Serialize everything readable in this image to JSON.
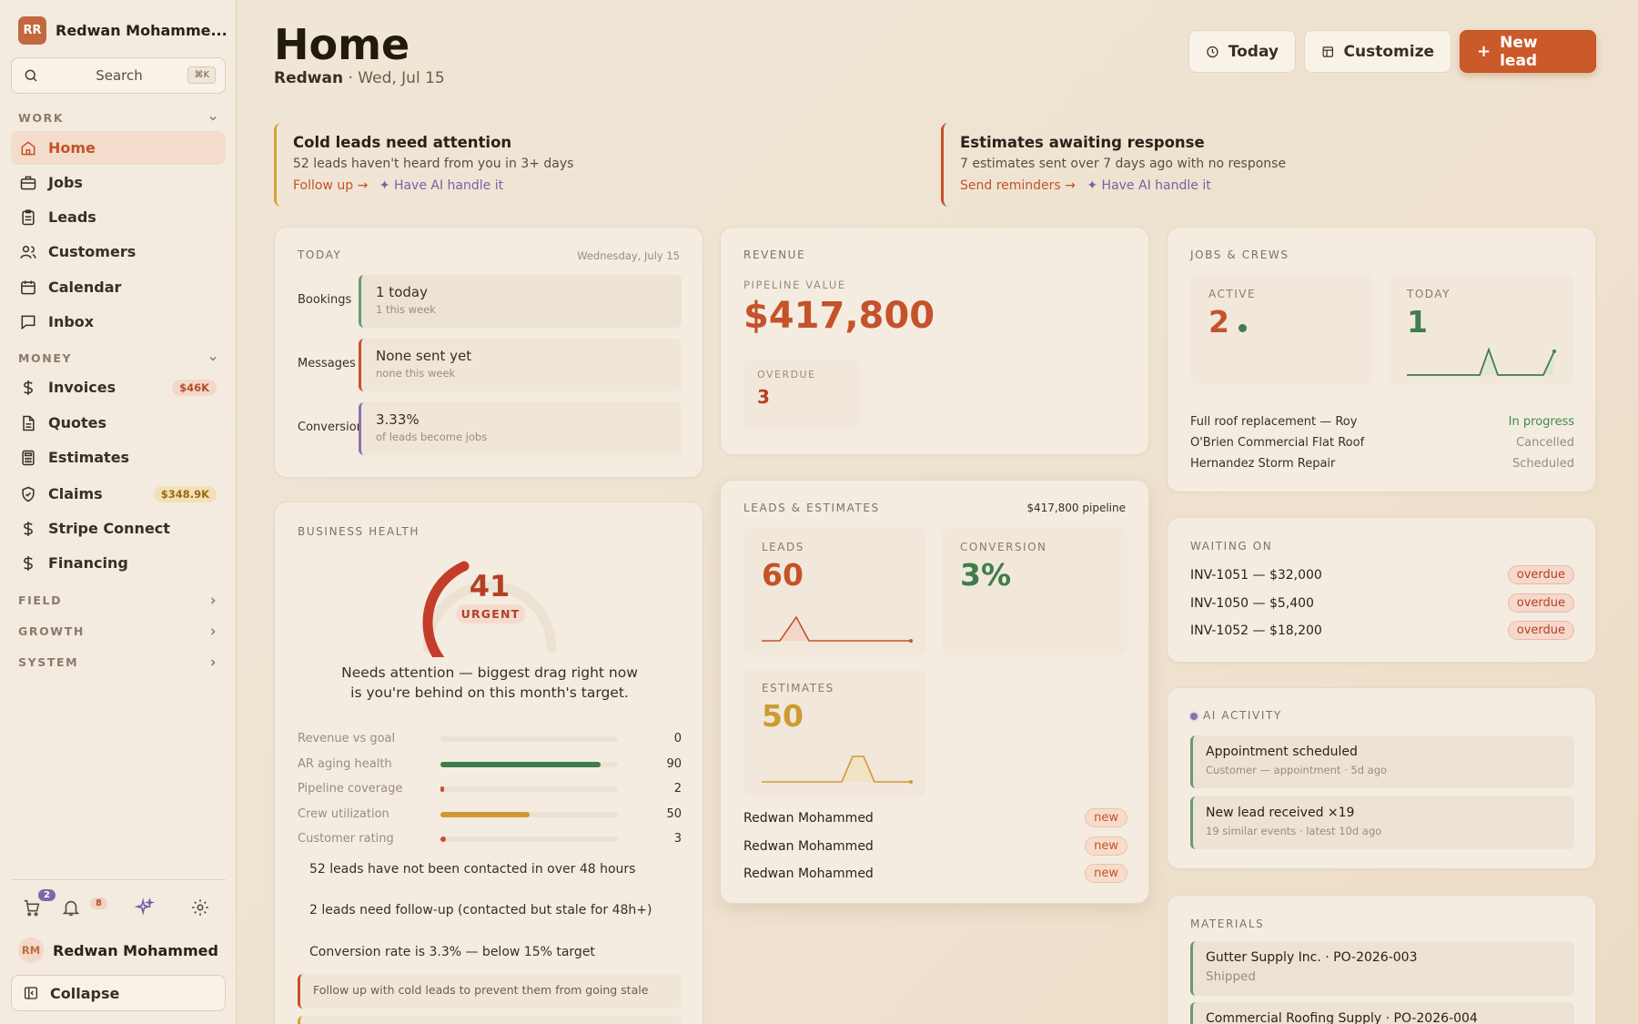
{
  "account": {
    "initials": "RR",
    "name": "Redwan Mohamme..."
  },
  "search": {
    "label": "Search",
    "shortcut": "⌘K"
  },
  "sidebar": {
    "work_label": "WORK",
    "money_label": "MONEY",
    "field_label": "FIELD",
    "growth_label": "GROWTH",
    "system_label": "SYSTEM",
    "work_items": [
      {
        "label": "Home",
        "icon": "home-icon"
      },
      {
        "label": "Jobs",
        "icon": "briefcase-icon"
      },
      {
        "label": "Leads",
        "icon": "clipboard-icon"
      },
      {
        "label": "Customers",
        "icon": "users-icon"
      },
      {
        "label": "Calendar",
        "icon": "calendar-icon"
      },
      {
        "label": "Inbox",
        "icon": "message-icon"
      }
    ],
    "money_items": [
      {
        "label": "Invoices",
        "badge": "$46K"
      },
      {
        "label": "Quotes",
        "badge": ""
      },
      {
        "label": "Estimates",
        "badge": ""
      },
      {
        "label": "Claims",
        "badge": "$348.9K"
      },
      {
        "label": "Stripe Connect",
        "badge": ""
      },
      {
        "label": "Financing",
        "badge": ""
      }
    ],
    "cart_badge": "2",
    "notif_badge": "8",
    "user": {
      "initials": "RM",
      "name": "Redwan Mohammed"
    },
    "collapse_label": "Collapse"
  },
  "header": {
    "title": "Home",
    "user": "Redwan",
    "sep": "·",
    "date": "Wed, Jul 15",
    "today_btn": "Today",
    "customize_btn": "Customize",
    "new_lead_btn": "New lead"
  },
  "alerts": [
    {
      "title": "Cold leads need attention",
      "desc": "52 leads haven't heard from you in 3+ days",
      "action": "Follow up →",
      "ai": "✦ Have AI handle it"
    },
    {
      "title": "Estimates awaiting response",
      "desc": "7 estimates sent over 7 days ago with no response",
      "action": "Send reminders →",
      "ai": "✦ Have AI handle it"
    }
  ],
  "today": {
    "label": "TODAY",
    "date": "Wednesday, July 15",
    "rows": [
      {
        "label": "Bookings",
        "main": "1 today",
        "sub": "1 this week"
      },
      {
        "label": "Messages",
        "main": "None sent yet",
        "sub": "none this week"
      },
      {
        "label": "Conversion",
        "main": "3.33%",
        "sub": "of leads become jobs"
      }
    ]
  },
  "revenue": {
    "label": "REVENUE",
    "pipeline_label": "PIPELINE VALUE",
    "pipeline_value": "$417,800",
    "overdue_label": "OVERDUE",
    "overdue_value": "3"
  },
  "jobs": {
    "label": "JOBS & CREWS",
    "active_label": "ACTIVE",
    "active_value": "2",
    "today_label": "TODAY",
    "today_value": "1",
    "rows": [
      {
        "name": "Full roof replacement — Roy",
        "status": "In progress"
      },
      {
        "name": "O'Brien Commercial Flat Roof",
        "status": "Cancelled"
      },
      {
        "name": "Hernandez Storm Repair",
        "status": "Scheduled"
      }
    ]
  },
  "health": {
    "label": "BUSINESS HEALTH",
    "score": "41",
    "score_fraction": 0.41,
    "status": "URGENT",
    "message_1": "Needs attention — biggest drag right now",
    "message_2": "is you're behind on this month's target.",
    "metrics": [
      {
        "label": "Revenue vs goal",
        "value": 0,
        "display": "0",
        "color": "#c9502c"
      },
      {
        "label": "AR aging health",
        "value": 90,
        "display": "90",
        "color": "#3f7d4a"
      },
      {
        "label": "Pipeline coverage",
        "value": 2,
        "display": "2",
        "color": "#c9502c"
      },
      {
        "label": "Crew utilization",
        "value": 50,
        "display": "50",
        "color": "#cf9a33"
      },
      {
        "label": "Customer rating",
        "value": 3,
        "display": "3",
        "color": "#c9502c"
      }
    ],
    "notes": [
      "52 leads have not been contacted in over 48 hours",
      "2 leads need follow-up (contacted but stale for 48h+)",
      "Conversion rate is 3.3% — below 15% target"
    ],
    "action": "Follow up with cold leads to prevent them from going stale"
  },
  "leads": {
    "label": "LEADS & ESTIMATES",
    "pipeline": "$417,800 pipeline",
    "leads_label": "LEADS",
    "leads_value": "60",
    "conversion_label": "CONVERSION",
    "conversion_value": "3%",
    "estimates_label": "ESTIMATES",
    "estimates_value": "50",
    "rows": [
      {
        "name": "Redwan Mohammed",
        "tag": "new"
      },
      {
        "name": "Redwan Mohammed",
        "tag": "new"
      },
      {
        "name": "Redwan Mohammed",
        "tag": "new"
      }
    ]
  },
  "waiting": {
    "label": "WAITING ON",
    "rows": [
      {
        "name": "INV-1051 — $32,000",
        "tag": "overdue"
      },
      {
        "name": "INV-1050 — $5,400",
        "tag": "overdue"
      },
      {
        "name": "INV-1052 — $18,200",
        "tag": "overdue"
      }
    ]
  },
  "ai": {
    "label": "AI ACTIVITY",
    "items": [
      {
        "main": "Appointment scheduled",
        "sub": "Customer — appointment · 5d ago"
      },
      {
        "main": "New lead received ×19",
        "sub": "19 similar events · latest 10d ago"
      }
    ]
  },
  "materials": {
    "label": "MATERIALS",
    "items": [
      {
        "main": "Gutter Supply Inc. · PO-2026-003",
        "sub": "Shipped"
      },
      {
        "main": "Commercial Roofing Supply · PO-2026-004",
        "sub": ""
      }
    ]
  },
  "colors": {
    "accent": "#cb5a2a",
    "green": "#3f7d4a",
    "amber": "#cf9a33",
    "purple": "#7b5ea7"
  }
}
